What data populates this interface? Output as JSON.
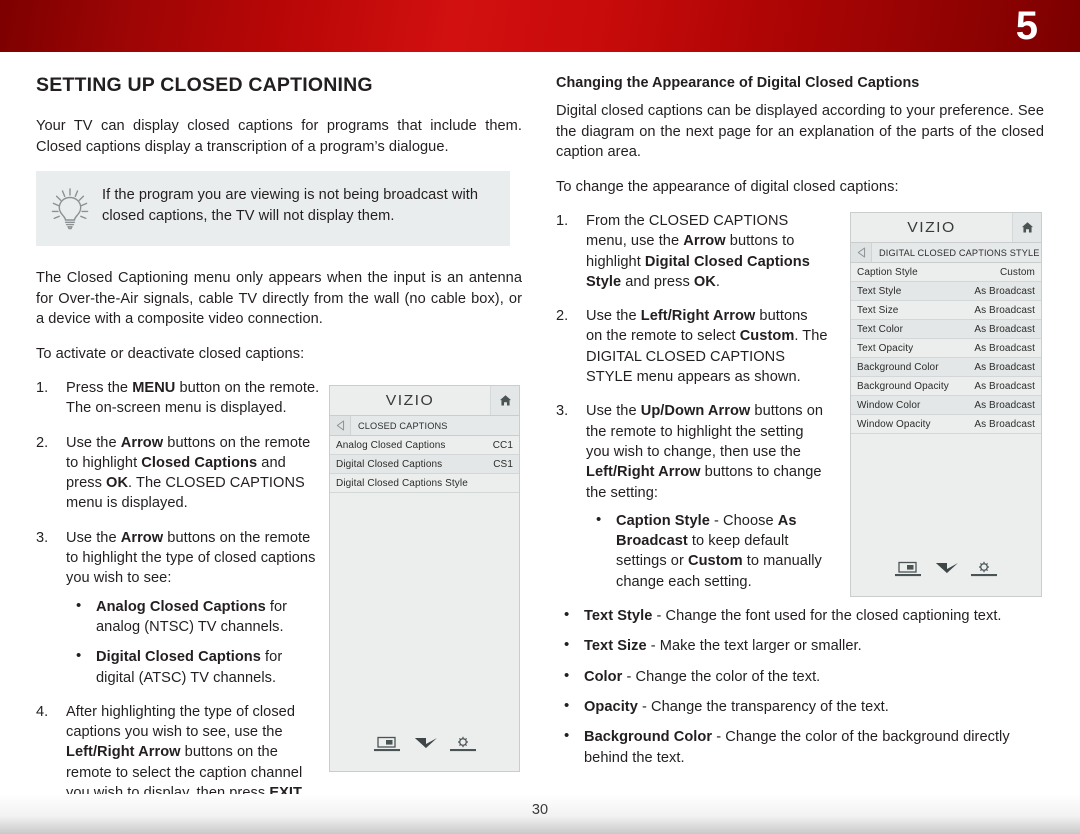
{
  "header": {
    "chapter_number": "5"
  },
  "footer": {
    "page_number": "30"
  },
  "left_column": {
    "title": "SETTING UP CLOSED CAPTIONING",
    "intro": "Your TV can display closed captions for programs that include them. Closed captions display a transcription of a program’s dialogue.",
    "tip": {
      "icon": "lightbulb-icon",
      "text": "If the program you are viewing is not being broadcast with closed captions, the TV will not display them."
    },
    "note": "The Closed Captioning menu only appears when the input is an antenna for Over-the-Air signals, cable TV directly from the wall (no cable box), or a device with a composite video connection.",
    "lead_in": "To activate or deactivate closed captions:",
    "steps": [
      {
        "num": "1.",
        "parts": [
          {
            "t": "Press the ",
            "b": false
          },
          {
            "t": "MENU",
            "b": true
          },
          {
            "t": " button on the remote. The on-screen menu is displayed.",
            "b": false
          }
        ]
      },
      {
        "num": "2.",
        "parts": [
          {
            "t": "Use the ",
            "b": false
          },
          {
            "t": "Arrow",
            "b": true
          },
          {
            "t": " buttons on the remote to highlight ",
            "b": false
          },
          {
            "t": "Closed Captions",
            "b": true
          },
          {
            "t": " and press ",
            "b": false
          },
          {
            "t": "OK",
            "b": true
          },
          {
            "t": ". The CLOSED CAPTIONS menu is displayed.",
            "b": false
          }
        ]
      },
      {
        "num": "3.",
        "parts": [
          {
            "t": "Use the ",
            "b": false
          },
          {
            "t": "Arrow",
            "b": true
          },
          {
            "t": " buttons on the remote to highlight the type of closed captions you wish to see:",
            "b": false
          }
        ],
        "bullets": [
          [
            {
              "t": "Analog Closed Captions",
              "b": true
            },
            {
              "t": " for analog (NTSC) TV channels.",
              "b": false
            }
          ],
          [
            {
              "t": "Digital Closed Captions",
              "b": true
            },
            {
              "t": " for digital (ATSC) TV channels.",
              "b": false
            }
          ]
        ]
      },
      {
        "num": "4.",
        "parts": [
          {
            "t": "After highlighting the type of closed captions you wish to see, use the ",
            "b": false
          },
          {
            "t": "Left/Right Arrow",
            "b": true
          },
          {
            "t": " buttons on the remote to select the caption channel you wish to display, then press ",
            "b": false
          },
          {
            "t": "EXIT",
            "b": true
          },
          {
            "t": ".",
            "b": false
          }
        ]
      }
    ]
  },
  "right_column": {
    "title": "Changing the Appearance of Digital Closed Captions",
    "intro": "Digital closed captions can be displayed according to your preference. See the diagram on the next page for an explanation of the parts of the closed caption area.",
    "lead_in": "To change the appearance of digital closed captions:",
    "steps": [
      {
        "num": "1.",
        "parts": [
          {
            "t": "From the CLOSED CAPTIONS menu, use the ",
            "b": false
          },
          {
            "t": "Arrow",
            "b": true
          },
          {
            "t": " buttons to highlight ",
            "b": false
          },
          {
            "t": "Digital Closed Captions Style",
            "b": true
          },
          {
            "t": " and press ",
            "b": false
          },
          {
            "t": "OK",
            "b": true
          },
          {
            "t": ".",
            "b": false
          }
        ]
      },
      {
        "num": "2.",
        "parts": [
          {
            "t": "Use the ",
            "b": false
          },
          {
            "t": "Left/Right Arrow",
            "b": true
          },
          {
            "t": " buttons on the remote to select ",
            "b": false
          },
          {
            "t": "Custom",
            "b": true
          },
          {
            "t": ". The DIGITAL CLOSED CAPTIONS STYLE menu appears as shown.",
            "b": false
          }
        ]
      },
      {
        "num": "3.",
        "parts": [
          {
            "t": "Use the ",
            "b": false
          },
          {
            "t": "Up/Down Arrow",
            "b": true
          },
          {
            "t": " buttons on the remote to highlight the setting you wish to change, then use the ",
            "b": false
          },
          {
            "t": "Left/Right Arrow",
            "b": true
          },
          {
            "t": " buttons to change the setting:",
            "b": false
          }
        ],
        "bullets": [
          [
            {
              "t": "Caption Style",
              "b": true
            },
            {
              "t": " - Choose ",
              "b": false
            },
            {
              "t": "As Broadcast",
              "b": true
            },
            {
              "t": " to keep default settings or ",
              "b": false
            },
            {
              "t": "Custom",
              "b": true
            },
            {
              "t": " to manually change each setting.",
              "b": false
            }
          ]
        ]
      }
    ],
    "outer_bullets": [
      [
        {
          "t": "Text Style",
          "b": true
        },
        {
          "t": "  - Change the font used for the closed captioning text.",
          "b": false
        }
      ],
      [
        {
          "t": "Text Size",
          "b": true
        },
        {
          "t": " - Make the text larger or smaller.",
          "b": false
        }
      ],
      [
        {
          "t": "Color",
          "b": true
        },
        {
          "t": " - Change the color of the text.",
          "b": false
        }
      ],
      [
        {
          "t": "Opacity",
          "b": true
        },
        {
          "t": " - Change the transparency of the text.",
          "b": false
        }
      ],
      [
        {
          "t": "Background Color",
          "b": true
        },
        {
          "t": " - Change the color of the background directly behind the text.",
          "b": false
        }
      ]
    ]
  },
  "tv_menu_closed_captions": {
    "brand": "VIZIO",
    "home_icon": "home-icon",
    "back_icon": "back-arrow-icon",
    "breadcrumb": "CLOSED CAPTIONS",
    "rows": [
      {
        "label": "Analog Closed Captions",
        "value": "CC1"
      },
      {
        "label": "Digital Closed Captions",
        "value": "CS1"
      },
      {
        "label": "Digital Closed Captions Style",
        "value": ""
      }
    ],
    "footer_icons": [
      "picture-mode-icon",
      "double-chevron-down-icon",
      "gear-icon"
    ]
  },
  "tv_menu_captions_style": {
    "brand": "VIZIO",
    "home_icon": "home-icon",
    "back_icon": "back-arrow-icon",
    "breadcrumb": "DIGITAL CLOSED CAPTIONS STYLE",
    "rows": [
      {
        "label": "Caption Style",
        "value": "Custom"
      },
      {
        "label": "Text Style",
        "value": "As Broadcast"
      },
      {
        "label": "Text Size",
        "value": "As Broadcast"
      },
      {
        "label": "Text Color",
        "value": "As Broadcast"
      },
      {
        "label": "Text Opacity",
        "value": "As Broadcast"
      },
      {
        "label": "Background Color",
        "value": "As Broadcast"
      },
      {
        "label": "Background Opacity",
        "value": "As Broadcast"
      },
      {
        "label": "Window Color",
        "value": "As Broadcast"
      },
      {
        "label": "Window Opacity",
        "value": "As Broadcast"
      }
    ],
    "footer_icons": [
      "picture-mode-icon",
      "double-chevron-down-icon",
      "gear-icon"
    ]
  },
  "colors": {
    "header_red": "#b80606",
    "tip_background": "#e9edee",
    "menu_background": "#eceeee",
    "menu_border": "#c9cdcd",
    "text": "#231f20"
  }
}
